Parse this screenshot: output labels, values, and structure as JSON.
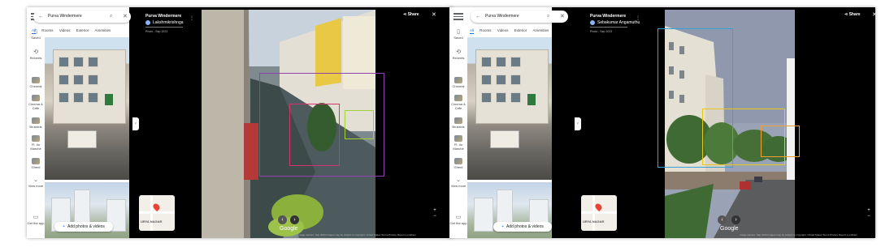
{
  "panels": [
    {
      "sidebar": {
        "items": [
          {
            "label": "Saved",
            "icon": "bookmark-icon"
          },
          {
            "label": "Recents",
            "icon": "history-icon"
          },
          {
            "label": "Chennai",
            "icon": "place-thumb"
          },
          {
            "label": "Cinema & Cafe",
            "icon": "place-thumb"
          },
          {
            "label": "Brussels",
            "icon": "place-thumb"
          },
          {
            "label": "Pl. du Marché",
            "icon": "place-thumb"
          },
          {
            "label": "Ghent",
            "icon": "place-thumb"
          },
          {
            "label": "View more",
            "icon": "more-icon"
          },
          {
            "label": "Get the app",
            "icon": "phone-icon"
          }
        ]
      },
      "search": {
        "query": "Purva Windermere"
      },
      "tabs": [
        "All",
        "Rooms",
        "Videos",
        "Exterior",
        "Amenities"
      ],
      "add_button": "Add photos & videos",
      "viewer": {
        "place": "Purva Windermere",
        "contributor": "Lakshmikrishnga",
        "date": "Photo - Sep 2023",
        "share": "Share",
        "google": "Google",
        "footer": "Image capture: Sep 2023   Images may be subject to copyright.   United States   Terms   Privacy   Report a problem",
        "minimap_label": "URYA NAGAR"
      }
    },
    {
      "sidebar": {
        "items": [
          {
            "label": "Saved",
            "icon": "bookmark-icon"
          },
          {
            "label": "Recents",
            "icon": "history-icon"
          },
          {
            "label": "Chennai",
            "icon": "place-thumb"
          },
          {
            "label": "Cinema & Cafe",
            "icon": "place-thumb"
          },
          {
            "label": "Brussels",
            "icon": "place-thumb"
          },
          {
            "label": "Pl. du Marché",
            "icon": "place-thumb"
          },
          {
            "label": "Ghent",
            "icon": "place-thumb"
          },
          {
            "label": "View more",
            "icon": "more-icon"
          },
          {
            "label": "Get the app",
            "icon": "phone-icon"
          }
        ]
      },
      "search": {
        "query": "Purva Windermere"
      },
      "tabs": [
        "All",
        "Rooms",
        "Videos",
        "Exterior",
        "Amenities"
      ],
      "add_button": "Add photos & videos",
      "viewer": {
        "place": "Purva Windermere",
        "contributor": "Sebakumar Angamuthu",
        "date": "Photo - Sep 2023",
        "share": "Share",
        "google": "Google",
        "footer": "Image capture: Sep 2023   Images may be subject to copyright.   United States   Terms   Privacy   Report a problem",
        "minimap_label": "URYA NAGAR"
      }
    }
  ],
  "colors": {
    "left_boxes": [
      "#8e44ad",
      "#d6336c",
      "#a3d13a"
    ],
    "right_boxes": [
      "#3aa0d8",
      "#e6c619",
      "#f0a030"
    ],
    "accent": "#1a73e8"
  }
}
